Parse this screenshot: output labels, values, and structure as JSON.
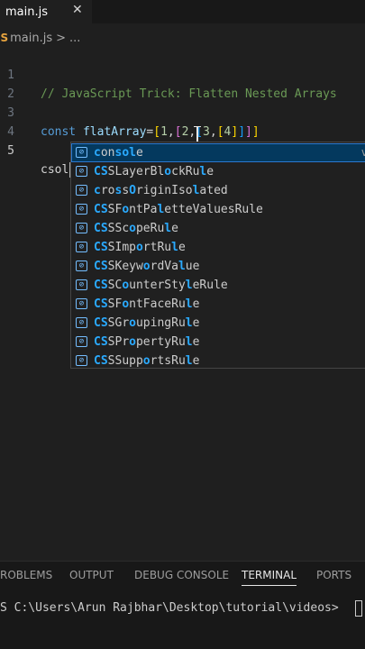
{
  "tab": {
    "label": "main.js",
    "close": "✕"
  },
  "breadcrumb": {
    "icon": "JS",
    "file": "main.js",
    "separator": ">",
    "more": "..."
  },
  "editor": {
    "lines": [
      {
        "number": "1",
        "comment": "// JavaScript Trick: Flatten Nested Arrays"
      },
      {
        "number": "2"
      },
      {
        "number": "3",
        "keyword": "const",
        "name": "flatArray",
        "op": "=",
        "value": "[1,[2,[3,[4]]]]"
      },
      {
        "number": "4"
      },
      {
        "number": "5",
        "typed": "csol"
      }
    ]
  },
  "suggestions": {
    "icon": "[⊘]",
    "items": [
      "console",
      "CSSLayerBlockRule",
      "crossOriginIsolated",
      "CSSFontPaletteValuesRule",
      "CSSScopeRule",
      "CSSImportRule",
      "CSSKeywordValue",
      "CSSCounterStyleRule",
      "CSSFontFaceRule",
      "CSSGroupingRule",
      "CSSPropertyRule",
      "CSSSupportsRule"
    ],
    "selected_detail": "v"
  },
  "panel": {
    "tabs": [
      "ROBLEMS",
      "OUTPUT",
      "DEBUG CONSOLE",
      "TERMINAL",
      "PORTS"
    ],
    "active_tab": "TERMINAL",
    "terminal_prompt": "S C:\\Users\\Arun Rajbhar\\Desktop\\tutorial\\videos>"
  },
  "colors": {
    "background": "#1f1f1f",
    "comment": "#6a9955",
    "keyword": "#569cd6",
    "variable": "#9cdcfe",
    "number": "#b5cea8",
    "selection": "#04395e",
    "match_highlight": "#2aaaff"
  }
}
